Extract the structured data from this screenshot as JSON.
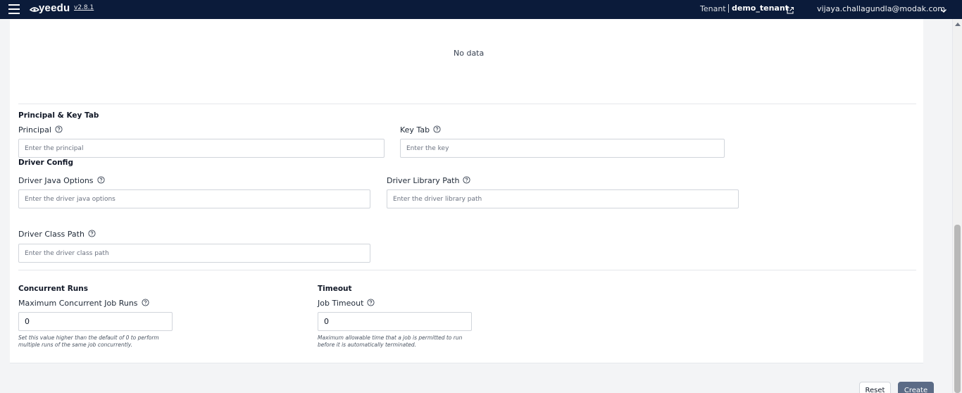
{
  "app": {
    "name": "yeedu",
    "version": "v2.8.1"
  },
  "header": {
    "tenant_label": "Tenant",
    "tenant_name": "demo_tenant",
    "user_email": "vijaya.challagundla@modak.com"
  },
  "table": {
    "empty_text": "No data"
  },
  "principal_section": {
    "title": "Principal & Key Tab",
    "principal_label": "Principal",
    "principal_placeholder": "Enter the principal",
    "keytab_label": "Key Tab",
    "keytab_placeholder": "Enter the key"
  },
  "driver_section": {
    "title": "Driver Config",
    "java_options_label": "Driver Java Options",
    "java_options_placeholder": "Enter the driver java options",
    "library_path_label": "Driver Library Path",
    "library_path_placeholder": "Enter the driver library path",
    "class_path_label": "Driver Class Path",
    "class_path_placeholder": "Enter the driver class path"
  },
  "concurrent_section": {
    "title": "Concurrent Runs",
    "label": "Maximum Concurrent Job Runs",
    "value": "0",
    "hint": "Set this value higher than the default of 0 to perform multiple runs of the same job concurrently."
  },
  "timeout_section": {
    "title": "Timeout",
    "label": "Job Timeout",
    "value": "0",
    "hint": "Maximum allowable time that a job is permitted to run before it is automatically terminated."
  },
  "actions": {
    "reset_label": "Reset",
    "create_label": "Create"
  },
  "colors": {
    "topbar": "#0b1b3a",
    "create_button": "#5b6b86"
  },
  "icons": [
    "menu-icon",
    "logo-icon",
    "external-link-icon",
    "chevron-down-icon",
    "help-icon"
  ]
}
